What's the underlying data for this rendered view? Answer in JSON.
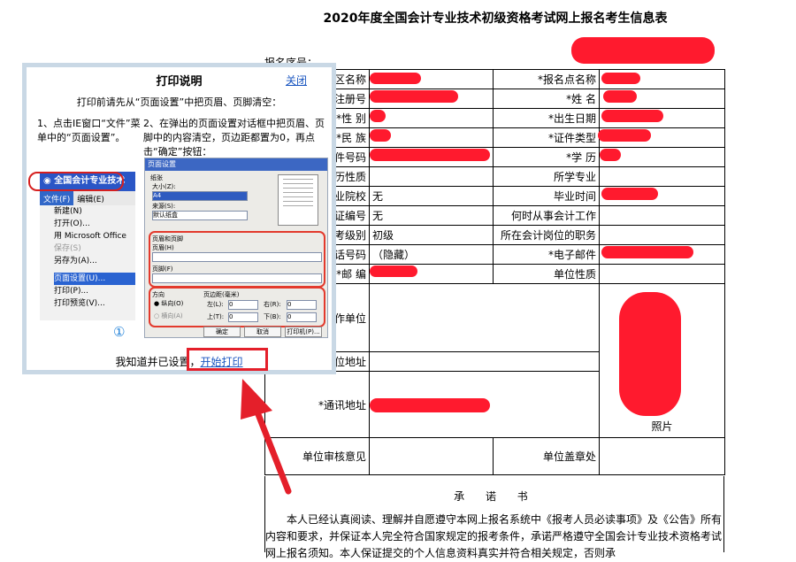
{
  "form": {
    "title": "2020年度全国会计专业技术初级资格考试网上报名考生信息表",
    "reg_no_label": "报名序号：",
    "rows": [
      {
        "l1": "区名称",
        "v1": "",
        "l2": "*报名点名称",
        "v2": ""
      },
      {
        "l1": "注册号",
        "v1": "",
        "l2": "*姓  名",
        "v2": ""
      },
      {
        "l1": "*性  别",
        "v1": "",
        "l2": "*出生日期",
        "v2": ""
      },
      {
        "l1": "*民  族",
        "v1": "",
        "l2": "*证件类型",
        "v2": ""
      },
      {
        "l1": "件号码",
        "v1": "",
        "l2": "*学  历",
        "v2": ""
      },
      {
        "l1": "历性质",
        "v1": "",
        "l2": "所学专业",
        "v2": ""
      },
      {
        "l1": "业院校",
        "v1": "无",
        "l2": "毕业时间",
        "v2": ""
      },
      {
        "l1": "证编号",
        "v1": "无",
        "l2": "何时从事会计工作",
        "v2": ""
      },
      {
        "l1": "考级别",
        "v1": "初级",
        "l2": "所在会计岗位的职务",
        "v2": ""
      },
      {
        "l1": "话号码",
        "v1": "（隐藏）",
        "l2": "*电子邮件",
        "v2": ""
      },
      {
        "l1": "*邮  编",
        "v1": "",
        "l2": "单位性质",
        "v2": ""
      }
    ],
    "work_unit_label": "作单位",
    "unit_address_label": "位地址",
    "mail_address_label": "*通讯地址",
    "photo_label": "照片",
    "unit_review_label": "单位审核意见",
    "unit_seal_label": "单位盖章处",
    "promise_title": "承 诺 书",
    "promise_text": "本人已经认真阅读、理解并自愿遵守本网上报名系统中《报考人员必读事项》及《公告》所有内容和要求，并保证本人完全符合国家规定的报考条件，承诺严格遵守全国会计专业技术资格考试网上报名须知。本人保证提交的个人信息资料真实并符合相关规定，否则承"
  },
  "dialog": {
    "title": "打印说明",
    "close_label": "关闭",
    "intro": "打印前请先从“页面设置”中把页眉、页脚清空：",
    "step1": "1、点击IE窗口“文件”菜单中的“页面设置”。",
    "step2": "2、在弹出的页面设置对话框中把页眉、页脚中的内容清空，页边距都置为0，再点击“确定”按钮：",
    "menu": {
      "window_title": "全国会计专业技术",
      "menu_file": "文件(F)",
      "menu_edit": "编辑(E)",
      "items": [
        "新建(N)",
        "打开(O)...",
        "用 Microsoft Office",
        "保存(S)",
        "另存为(A)...",
        "页面设置(U)...",
        "打印(P)...",
        "打印预览(V)..."
      ]
    },
    "page_setup": {
      "title": "页面设置",
      "paper_label": "纸张",
      "size_label": "大小(Z):",
      "size_value": "A4",
      "source_label": "来源(S):",
      "source_value": "默认纸盒",
      "header_footer_label": "页眉和页脚",
      "header_label": "页眉(H)",
      "footer_label": "页脚(F)",
      "orientation_label": "方向",
      "portrait_label": "纵向(O)",
      "landscape_label": "横向(A)",
      "margins_label": "页边距(毫米)",
      "left_label": "左(L):",
      "right_label": "右(R):",
      "top_label": "上(T):",
      "bottom_label": "下(B):",
      "margin_value": "0",
      "ok_label": "确定",
      "cancel_label": "取消",
      "printer_label": "打印机(P)..."
    },
    "step_marker": "①",
    "confirm_text": "我知道并已设置，",
    "start_print": "开始打印"
  },
  "colors": {
    "redaction": "#ff1a2e",
    "highlight": "#e41f2a",
    "link": "#1a56c0",
    "dialog_frame": "#c9d8e5"
  }
}
